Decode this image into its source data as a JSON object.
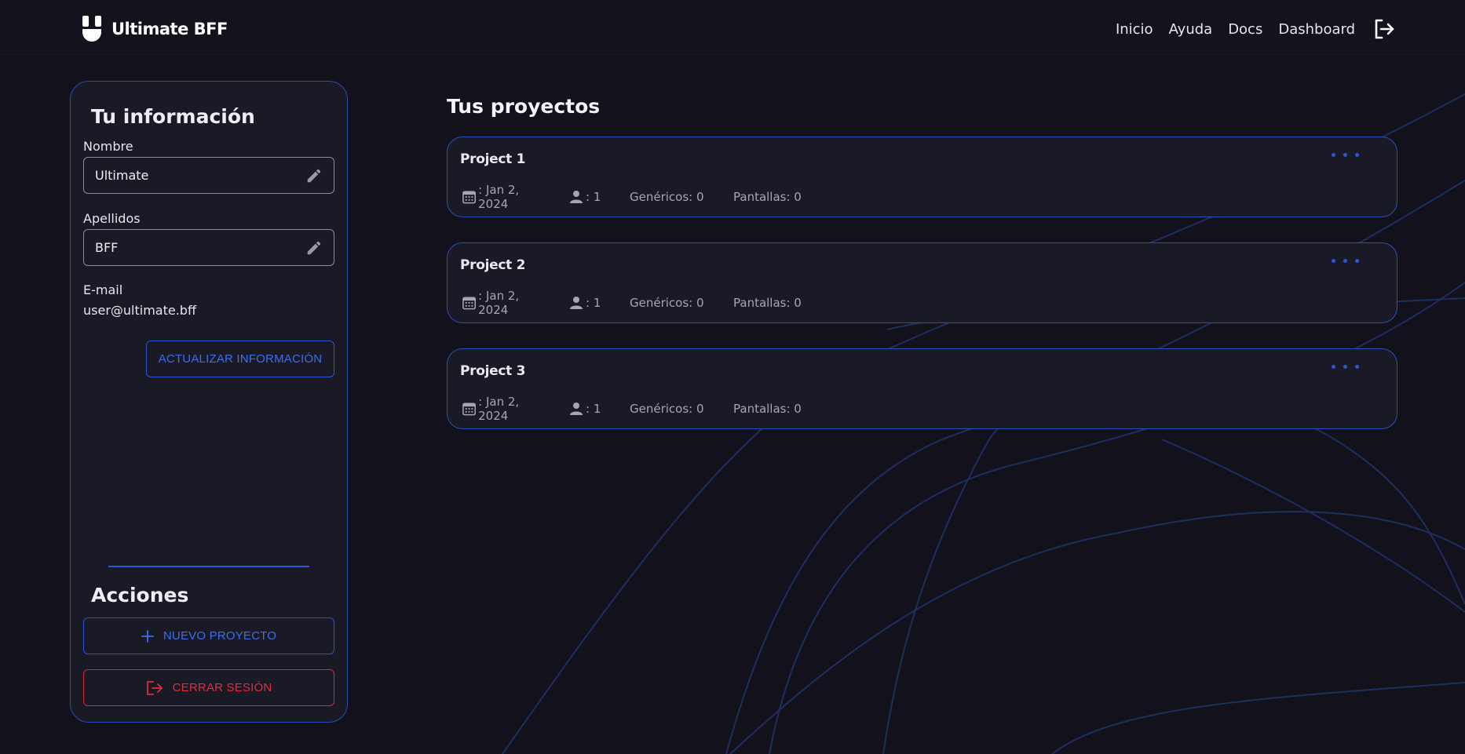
{
  "header": {
    "brand_name": "Ultimate BFF",
    "nav": [
      "Inicio",
      "Ayuda",
      "Docs",
      "Dashboard"
    ]
  },
  "sidebar": {
    "title": "Tu información",
    "fields": {
      "nombre": {
        "label": "Nombre",
        "value": "Ultimate"
      },
      "apellidos": {
        "label": "Apellidos",
        "value": "BFF"
      },
      "email": {
        "label": "E-mail",
        "value": "user@ultimate.bff"
      }
    },
    "update_button": "ACTUALIZAR INFORMACIÓN",
    "actions_title": "Acciones",
    "new_project_button": "NUEVO PROYECTO",
    "logout_button": "CERRAR SESIÓN"
  },
  "projects": {
    "title": "Tus proyectos",
    "items": [
      {
        "name": "Project 1",
        "date": ": Jan 2, 2024",
        "members": ": 1",
        "genericos": "Genéricos: 0",
        "pantallas": "Pantallas: 0"
      },
      {
        "name": "Project 2",
        "date": ": Jan 2, 2024",
        "members": ": 1",
        "genericos": "Genéricos: 0",
        "pantallas": "Pantallas: 0"
      },
      {
        "name": "Project 3",
        "date": ": Jan 2, 2024",
        "members": ": 1",
        "genericos": "Genéricos: 0",
        "pantallas": "Pantallas: 0"
      }
    ]
  },
  "colors": {
    "background": "#12111c",
    "card": "#1a1926",
    "accent": "#2c56d6",
    "danger": "#e12d3d"
  },
  "icons": [
    "brand-logo",
    "logout-icon",
    "pencil-icon",
    "plus-icon",
    "calendar-icon",
    "person-icon",
    "more-dots-icon"
  ]
}
